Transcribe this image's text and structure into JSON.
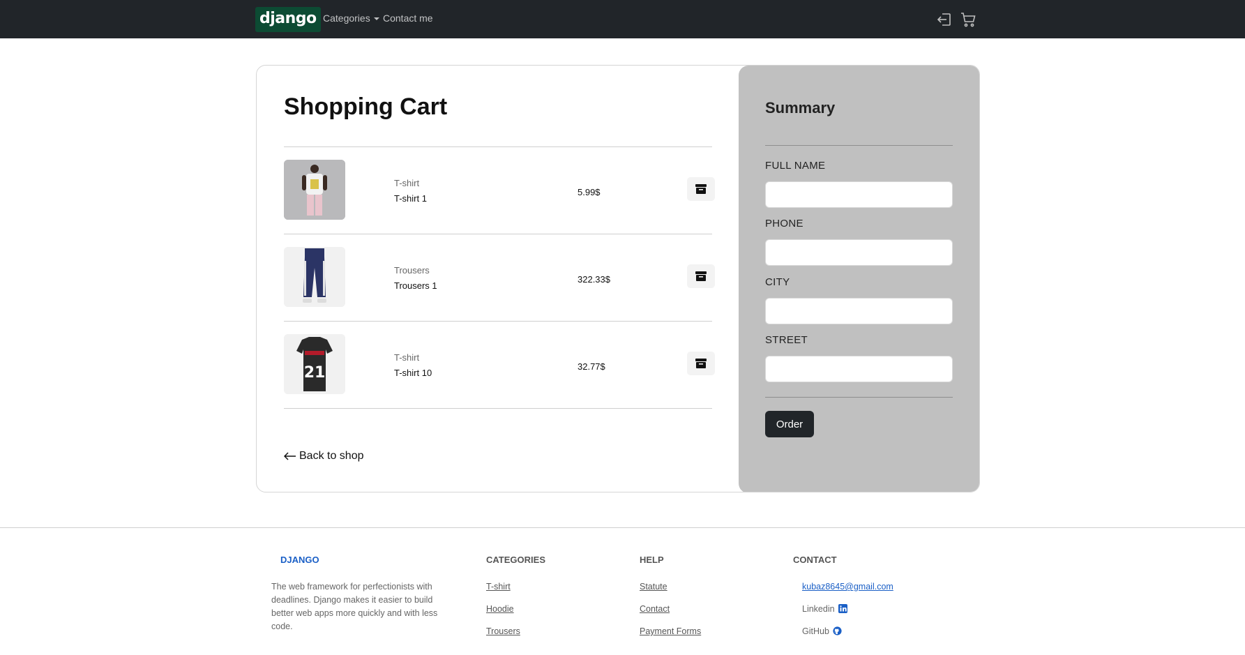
{
  "navbar": {
    "brand": "django",
    "categories_label": "Categories",
    "contact_label": "Contact me"
  },
  "cart": {
    "title": "Shopping Cart",
    "items": [
      {
        "category": "T-shirt",
        "name": "T-shirt 1",
        "price": "5.99$"
      },
      {
        "category": "Trousers",
        "name": "Trousers 1",
        "price": "322.33$"
      },
      {
        "category": "T-shirt",
        "name": "T-shirt 10",
        "price": "32.77$"
      }
    ],
    "back_label": "Back to shop"
  },
  "summary": {
    "title": "Summary",
    "fields": [
      {
        "label": "FULL NAME"
      },
      {
        "label": "PHONE"
      },
      {
        "label": "CITY"
      },
      {
        "label": "STREET"
      }
    ],
    "order_label": "Order"
  },
  "footer": {
    "brand": "DJANGO",
    "description": "The web framework for perfectionists with deadlines. Django makes it easier to build better web apps more quickly and with less code.",
    "categories_heading": "CATEGORIES",
    "categories": [
      "T-shirt",
      "Hoodie",
      "Trousers"
    ],
    "help_heading": "HELP",
    "help_links": [
      "Statute",
      "Contact",
      "Payment Forms"
    ],
    "contact_heading": "CONTACT",
    "email": "kubaz8645@gmail.com",
    "linkedin": "Linkedin",
    "github": "GitHub"
  },
  "colors": {
    "navbar": "#212529",
    "brand_bg": "#0c4b33",
    "summary_bg": "#c0c0c0",
    "link_blue": "#1a5fc6"
  }
}
